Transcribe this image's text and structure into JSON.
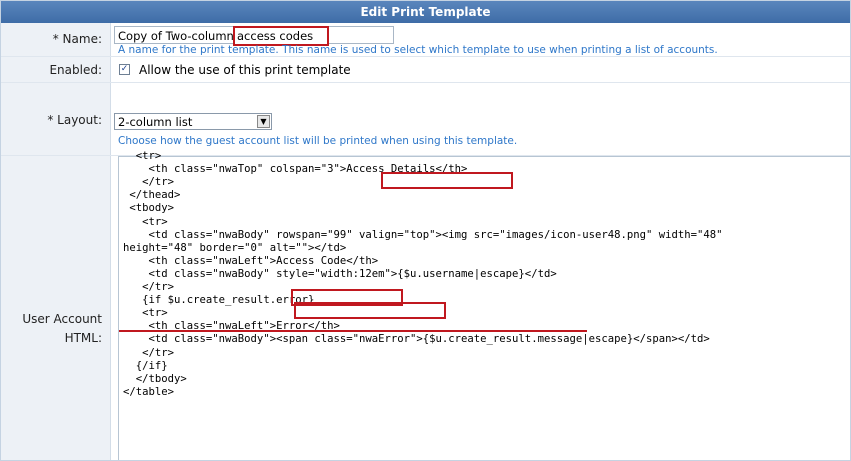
{
  "header": {
    "title": "Edit Print Template"
  },
  "name_row": {
    "required_mark": "*",
    "label": "Name:",
    "value_prefix": "Copy of Two-column",
    "value_highlight": "access codes",
    "hint": "A name for the print template. This name is used to select which template to use when printing a list of accounts."
  },
  "enabled_row": {
    "label": "Enabled:",
    "checked": true,
    "check_glyph": "✓",
    "checkbox_label": "Allow the use of this print template"
  },
  "layout_row": {
    "required_mark": "*",
    "label": "Layout:",
    "selected": "2-column list",
    "hint": "Choose how the guest account list will be printed when using this template.",
    "dropdown_glyph": "▼"
  },
  "user_html_row": {
    "label_line1": "User Account",
    "label_line2": "HTML:",
    "lines": [
      "  <tr>",
      "    <th class=\"nwaTop\" colspan=\"3\">Access Details</th>",
      "   </tr>",
      " </thead>",
      " <tbody>",
      "   <tr>",
      "    <td class=\"nwaBody\" rowspan=\"99\" valign=\"top\"><img src=\"images/icon-user48.png\" width=\"48\"",
      "height=\"48\" border=\"0\" alt=\"\"></td>",
      "    <th class=\"nwaLeft\">Access Code</th>",
      "    <td class=\"nwaBody\" style=\"width:12em\">{$u.username|escape}</td>",
      "   </tr>",
      "   {if $u.create_result.error}",
      "   <tr>",
      "    <th class=\"nwaLeft\">Error</th>",
      "    <td class=\"nwaBody\"><span class=\"nwaError\">{$u.create_result.message|escape}</span></td>",
      "   </tr>",
      "  {/if}",
      "  </tbody>",
      "</table>"
    ]
  },
  "colors": {
    "header": "#4a78b4",
    "highlight": "#c0181f",
    "hint": "#2e77c9",
    "label_bg": "#edf1f6"
  }
}
